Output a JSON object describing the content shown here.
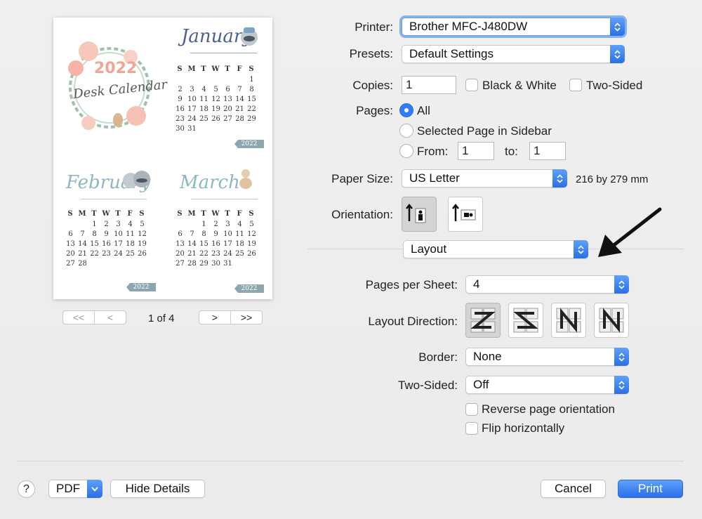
{
  "preview": {
    "wreath_year": "2022",
    "wreath_title": "Desk Calendar",
    "year_tag": "2022",
    "page_indicator": "1 of 4",
    "nav": {
      "first": "<<",
      "prev": "<",
      "next": ">",
      "last": ">>"
    },
    "months": [
      {
        "name": "January",
        "days_header": [
          "S",
          "M",
          "T",
          "W",
          "T",
          "F",
          "S"
        ],
        "cells": [
          "",
          "",
          "",
          "",
          "",
          "",
          "1",
          "2",
          "3",
          "4",
          "5",
          "6",
          "7",
          "8",
          "9",
          "10",
          "11",
          "12",
          "13",
          "14",
          "15",
          "16",
          "17",
          "18",
          "19",
          "20",
          "21",
          "22",
          "23",
          "24",
          "25",
          "26",
          "27",
          "28",
          "29",
          "30",
          "31"
        ]
      },
      {
        "name": "February",
        "days_header": [
          "S",
          "M",
          "T",
          "W",
          "T",
          "F",
          "S"
        ],
        "cells": [
          "",
          "",
          "1",
          "2",
          "3",
          "4",
          "5",
          "6",
          "7",
          "8",
          "9",
          "10",
          "11",
          "12",
          "13",
          "14",
          "15",
          "16",
          "17",
          "18",
          "19",
          "20",
          "21",
          "22",
          "23",
          "24",
          "25",
          "26",
          "27",
          "28"
        ]
      },
      {
        "name": "March",
        "days_header": [
          "S",
          "M",
          "T",
          "W",
          "T",
          "F",
          "S"
        ],
        "cells": [
          "",
          "",
          "1",
          "2",
          "3",
          "4",
          "5",
          "6",
          "7",
          "8",
          "9",
          "10",
          "11",
          "12",
          "13",
          "14",
          "15",
          "16",
          "17",
          "18",
          "19",
          "20",
          "21",
          "22",
          "23",
          "24",
          "25",
          "26",
          "27",
          "28",
          "29",
          "30",
          "31"
        ]
      }
    ]
  },
  "settings": {
    "printer_label": "Printer:",
    "printer_value": "Brother MFC-J480DW",
    "presets_label": "Presets:",
    "presets_value": "Default Settings",
    "copies_label": "Copies:",
    "copies_value": "1",
    "bw_label": "Black & White",
    "two_sided_label": "Two-Sided",
    "pages_label": "Pages:",
    "pages_all": "All",
    "pages_selected": "Selected Page in Sidebar",
    "pages_from": "From:",
    "from_value": "1",
    "to_label": "to:",
    "to_value": "1",
    "paper_size_label": "Paper Size:",
    "paper_size_value": "US Letter",
    "paper_dimensions": "216 by 279 mm",
    "orientation_label": "Orientation:",
    "section_value": "Layout",
    "pages_per_sheet_label": "Pages per Sheet:",
    "pages_per_sheet_value": "4",
    "layout_direction_label": "Layout Direction:",
    "border_label": "Border:",
    "border_value": "None",
    "two_sided_select_label": "Two-Sided:",
    "two_sided_value": "Off",
    "reverse_label": "Reverse page orientation",
    "flip_label": "Flip horizontally"
  },
  "footer": {
    "help": "?",
    "pdf": "PDF",
    "hide_details": "Hide Details",
    "cancel": "Cancel",
    "print": "Print"
  },
  "colors": {
    "accent": "#2f7cf6",
    "january": "#4a5f95",
    "feb_march": "#8bb9be",
    "tag": "#8aa7b0"
  }
}
